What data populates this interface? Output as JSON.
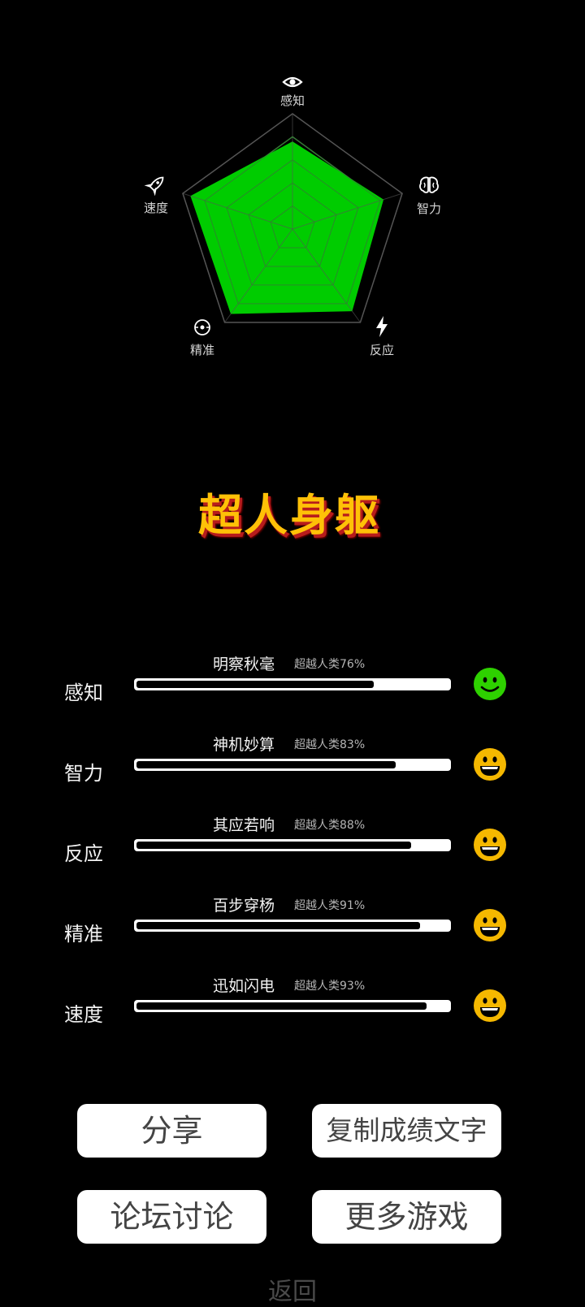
{
  "radar": {
    "axes": [
      {
        "label": "感知",
        "icon": "eye-icon",
        "value": 0.76
      },
      {
        "label": "智力",
        "icon": "brain-icon",
        "value": 0.83
      },
      {
        "label": "反应",
        "icon": "lightning-icon",
        "value": 0.88
      },
      {
        "label": "精准",
        "icon": "target-icon",
        "value": 0.91
      },
      {
        "label": "速度",
        "icon": "rocket-icon",
        "value": 0.93
      }
    ],
    "fill_color": "#00cc00",
    "grid_color": "#555555"
  },
  "rank_title": "超人身躯",
  "stats": [
    {
      "name": "感知",
      "title": "明察秋毫",
      "pct_text": "超越人类76%",
      "value": 0.76,
      "face": "smile-icon",
      "face_color": "#2ed100"
    },
    {
      "name": "智力",
      "title": "神机妙算",
      "pct_text": "超越人类83%",
      "value": 0.83,
      "face": "grin-icon",
      "face_color": "#f5b800"
    },
    {
      "name": "反应",
      "title": "其应若响",
      "pct_text": "超越人类88%",
      "value": 0.88,
      "face": "grin-icon",
      "face_color": "#f5b800"
    },
    {
      "name": "精准",
      "title": "百步穿杨",
      "pct_text": "超越人类91%",
      "value": 0.91,
      "face": "grin-icon",
      "face_color": "#f5b800"
    },
    {
      "name": "速度",
      "title": "迅如闪电",
      "pct_text": "超越人类93%",
      "value": 0.93,
      "face": "grin-icon",
      "face_color": "#f5b800"
    }
  ],
  "buttons": {
    "share": "分享",
    "copy": "复制成绩文字",
    "forum": "论坛讨论",
    "more_games": "更多游戏"
  },
  "back": "返回"
}
